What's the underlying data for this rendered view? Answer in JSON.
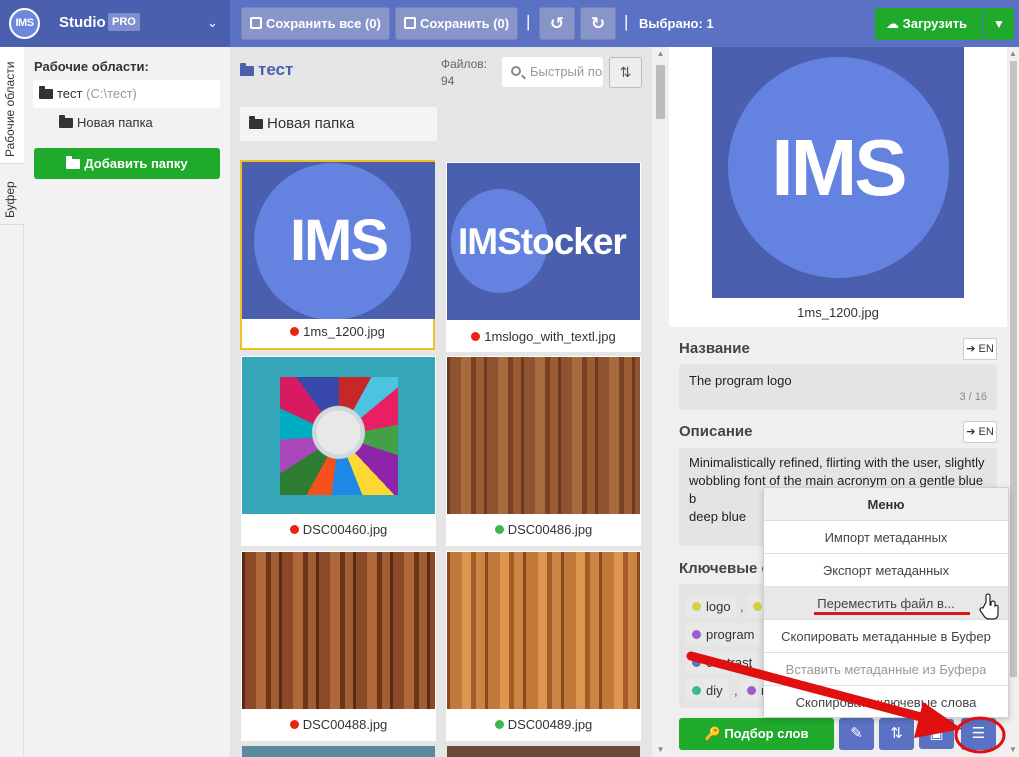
{
  "topbar": {
    "logo_text": "IMS",
    "brand": "Studio",
    "pro_badge": "PRO",
    "save_all_label": "Сохранить все (0)",
    "save_label": "Сохранить (0)",
    "selected_text": "Выбрано: 1",
    "upload_label": "Загрузить",
    "colors": {
      "bar": "#5b72c4",
      "brand_bg": "#4a5fae",
      "green": "#1faa2c"
    }
  },
  "side_tabs": [
    "Рабочие области",
    "Буфер"
  ],
  "workspaces": {
    "title": "Рабочие области:",
    "item_name": "тест",
    "item_path": "(C:\\тест)",
    "subfolder": "Новая папка",
    "add_button": "Добавить папку"
  },
  "grid": {
    "folder_title": "тест",
    "files_count": "Файлов: 94",
    "search_placeholder": "Быстрый поиск",
    "subfolder": "Новая папка",
    "tiles": [
      {
        "name": "1ms_1200.jpg",
        "status": "red",
        "image": "ims-logo"
      },
      {
        "name": "1mslogo_with_textl.jpg",
        "status": "red",
        "image": "imstocker-logo"
      },
      {
        "name": "DSC00460.jpg",
        "status": "red",
        "image": "yarn-spools"
      },
      {
        "name": "DSC00486.jpg",
        "status": "green",
        "image": "wood-planks"
      },
      {
        "name": "DSC00488.jpg",
        "status": "red",
        "image": "wood-planks"
      },
      {
        "name": "DSC00489.jpg",
        "status": "green",
        "image": "wood-planks"
      }
    ],
    "logo_big": "IMS",
    "logo_wide": "IMStocker",
    "status_colors": {
      "red": "#e8240c",
      "green": "#3cb84a"
    }
  },
  "details": {
    "preview_logo": "IMS",
    "file_name": "1ms_1200.jpg",
    "title_label": "Название",
    "title_value": "The program logo",
    "title_counter": "3 / 16",
    "desc_label": "Описание",
    "desc_value": "Minimalistically refined, flirting with the user, slightly wobbling font of the main acronym on a gentle blue b",
    "desc_tail": "deep blue",
    "en_button": "➔ EN",
    "keywords_label": "Ключевые с",
    "keywords": [
      {
        "word": "logo",
        "color": "#d4d04a"
      },
      {
        "word": "program",
        "color": "#a05ccc"
      },
      {
        "word": "contrast",
        "color": "#5b72c4"
      },
      {
        "word": "diy",
        "color": "#3cb88a"
      },
      {
        "word": "n",
        "color": "#a05ccc"
      }
    ],
    "pick_words_button": "Подбор слов"
  },
  "menu": {
    "title": "Меню",
    "items": [
      "Импорт метаданных",
      "Экспорт метаданных",
      "Переместить файл в...",
      "Скопировать метаданные в Буфер",
      "Вставить метаданные из Буфера",
      "Скопировать ключевые слова"
    ]
  }
}
